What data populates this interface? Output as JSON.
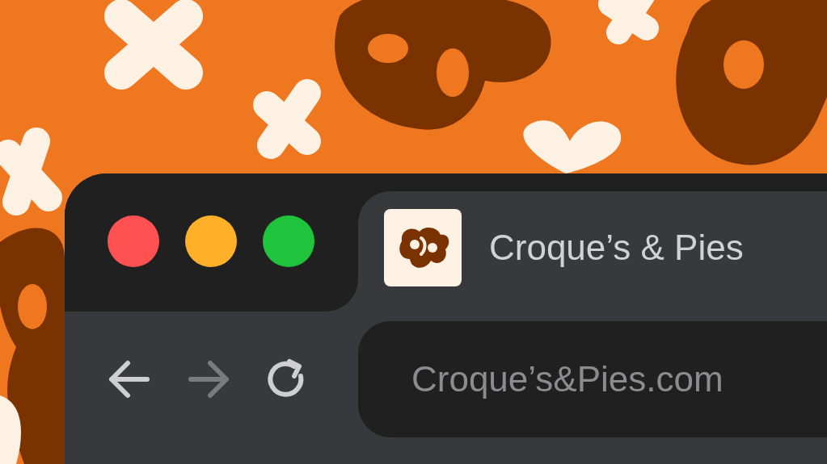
{
  "window": {
    "controls": [
      {
        "color": "#ff5151"
      },
      {
        "color": "#feb128"
      },
      {
        "color": "#1fc43c"
      }
    ]
  },
  "tabs": [
    {
      "title": "Croque’s & Pies",
      "selected": true
    }
  ],
  "toolbar": {
    "buttons": [
      {
        "kind": "back",
        "disabled": false
      },
      {
        "kind": "forward",
        "disabled": true
      },
      {
        "kind": "reload",
        "disabled": false
      }
    ]
  },
  "address_bar": {
    "value": "Croque’s&Pies.com"
  }
}
